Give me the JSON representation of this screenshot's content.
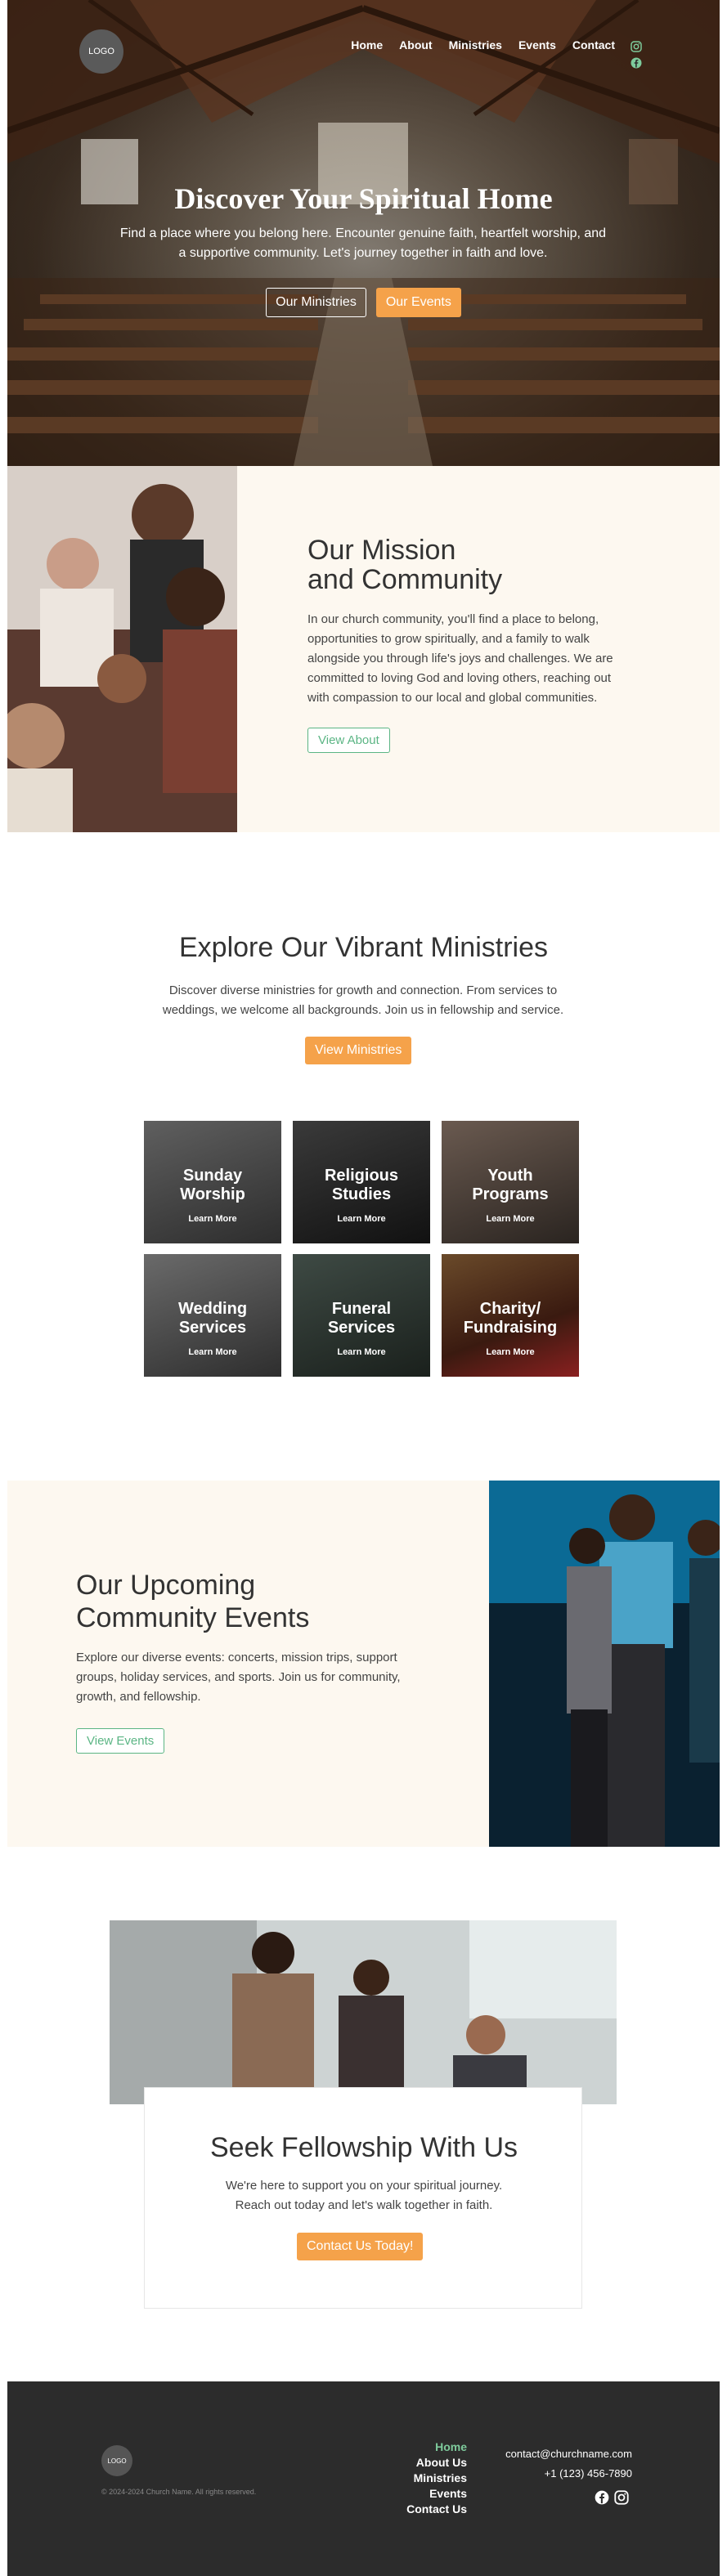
{
  "header": {
    "logo": "LOGO",
    "nav": [
      "Home",
      "About",
      "Ministries",
      "Events",
      "Contact"
    ]
  },
  "hero": {
    "title": "Discover Your Spiritual Home",
    "text": "Find a place where you belong here. Encounter genuine faith, heartfelt worship, and a supportive community. Let's journey together in faith and love.",
    "btn_ministries": "Our Ministries",
    "btn_events": "Our Events"
  },
  "mission": {
    "title_line1": "Our Mission",
    "title_line2": "and Community",
    "text": "In our church community, you'll find a place to belong, opportunities to grow spiritually, and a family to walk alongside you through life's joys and challenges. We are committed to loving God and loving others, reaching out with compassion to our local and global communities.",
    "button": "View About"
  },
  "ministries": {
    "title": "Explore Our Vibrant Ministries",
    "text": "Discover diverse ministries for growth and connection. From services to weddings, we welcome all backgrounds. Join us in fellowship and service.",
    "button": "View Ministries",
    "cards": [
      {
        "line1": "Sunday",
        "line2": "Worship",
        "link": "Learn More"
      },
      {
        "line1": "Religious",
        "line2": "Studies",
        "link": "Learn More"
      },
      {
        "line1": "Youth",
        "line2": "Programs",
        "link": "Learn More"
      },
      {
        "line1": "Wedding",
        "line2": "Services",
        "link": "Learn More"
      },
      {
        "line1": "Funeral",
        "line2": "Services",
        "link": "Learn More"
      },
      {
        "line1": "Charity/",
        "line2": "Fundraising",
        "link": "Learn More"
      }
    ]
  },
  "events": {
    "title_line1": "Our Upcoming",
    "title_line2": "Community Events",
    "text": "Explore our diverse events: concerts, mission trips, support groups, holiday services, and sports. Join us for community, growth, and fellowship.",
    "button": "View Events"
  },
  "fellowship": {
    "title": "Seek Fellowship With Us",
    "line1": "We're here to support you on your spiritual journey.",
    "line2": "Reach out today and let's walk together in faith.",
    "button": "Contact Us Today!"
  },
  "footer": {
    "logo": "LOGO",
    "copyright": "©  2024-2024 Church Name. All rights reserved.",
    "links": [
      "Home",
      "About Us",
      "Ministries",
      "Events",
      "Contact Us"
    ],
    "email": "contact@churchname.com",
    "phone": "+1 (123) 456-7890"
  },
  "colors": {
    "accent_orange": "#f5a24a",
    "accent_green": "#5bb584",
    "cream": "#fdf8f0",
    "footer_bg": "#2c2c2c"
  },
  "icons": [
    "instagram-icon",
    "facebook-icon"
  ]
}
